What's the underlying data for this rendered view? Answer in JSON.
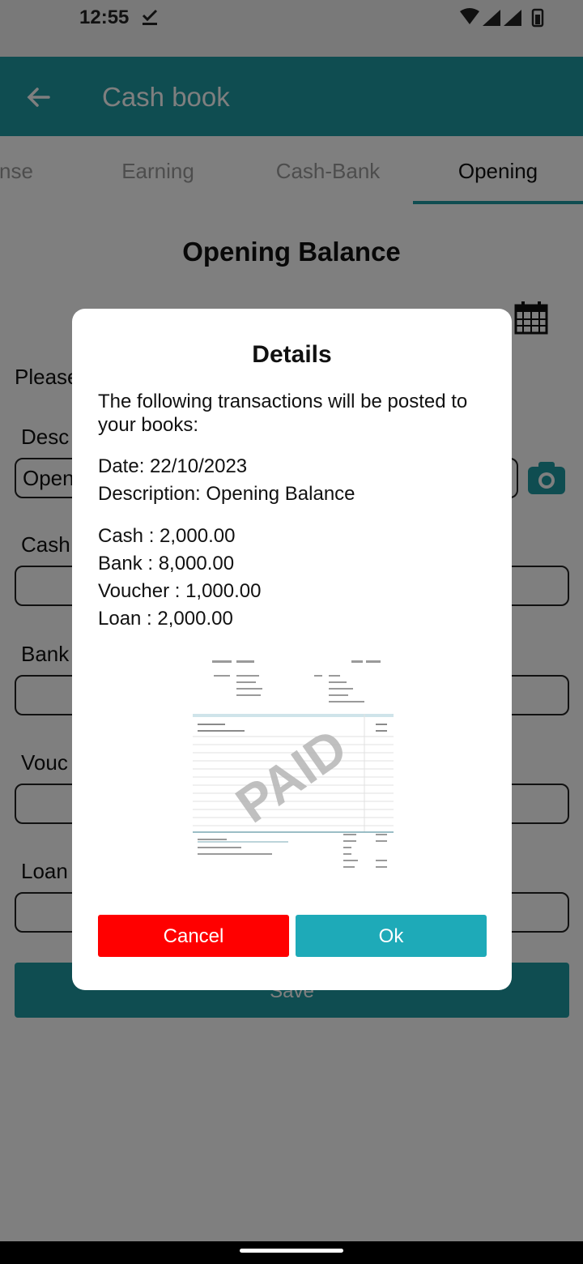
{
  "status_bar": {
    "time": "12:55"
  },
  "app_bar": {
    "title": "Cash book"
  },
  "tabs": [
    {
      "label": "nse",
      "active": false
    },
    {
      "label": "Earning",
      "active": false
    },
    {
      "label": "Cash-Bank",
      "active": false
    },
    {
      "label": "Opening",
      "active": true
    }
  ],
  "form": {
    "heading": "Opening Balance",
    "hint": "Please",
    "description_label": "Desc",
    "description_value": "Open",
    "cash_label": "Cash",
    "bank_label": "Bank",
    "voucher_label": "Vouc",
    "loan_label": "Loan",
    "save_label": "Save"
  },
  "dialog": {
    "title": "Details",
    "intro": "The following transactions will be posted to your books:",
    "date_line": "Date: 22/10/2023",
    "description_line": "Description: Opening Balance",
    "cash_line": "Cash : 2,000.00",
    "bank_line": "Bank : 8,000.00",
    "voucher_line": "Voucher : 1,000.00",
    "loan_line": "Loan : 2,000.00",
    "receipt_stamp": "PAID",
    "cancel_label": "Cancel",
    "ok_label": "Ok"
  },
  "colors": {
    "primary": "#1e9aa3",
    "cancel": "#ff0000",
    "ok": "#1eaab8"
  },
  "icons": [
    "back-arrow-icon",
    "calendar-icon",
    "camera-icon",
    "check-icon",
    "wifi-icon",
    "signal-icon",
    "battery-icon"
  ]
}
